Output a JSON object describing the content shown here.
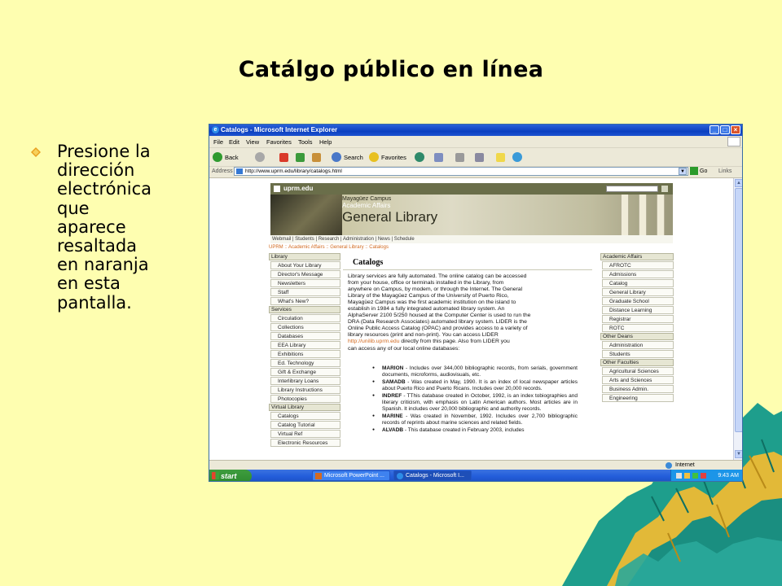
{
  "slide": {
    "title": "Catálgo público en línea",
    "bullet_lines": [
      "Presione la",
      "dirección",
      "electrónica",
      "que",
      "aparece",
      "resaltada",
      "en naranja",
      "en esta",
      "pantalla."
    ]
  },
  "window": {
    "title": "Catalogs - Microsoft Internet Explorer",
    "menu": [
      "File",
      "Edit",
      "View",
      "Favorites",
      "Tools",
      "Help"
    ],
    "toolbar": {
      "back": "Back",
      "search": "Search",
      "favorites": "Favorites"
    },
    "address_label": "Address",
    "address_url": "http://www.uprm.edu/library/catalogs.html",
    "go_label": "Go",
    "links_label": "Links",
    "status_zone": "Internet"
  },
  "page": {
    "site_label": "uprm.edu",
    "banner_campus": "Mayagüez Campus",
    "banner_affairs": "Academic Affairs",
    "banner_library": "General Library",
    "subnav": "Webmail | Students | Research | Administration | News | Schedule",
    "breadcrumb": "UPRM :: Academic Affairs :: General Library :: Catalogs",
    "left_nav": [
      {
        "header": "Library",
        "items": [
          "About Your Library",
          "Director's Message",
          "Newsletters",
          "Staff",
          "What's New?"
        ]
      },
      {
        "header": "Services",
        "items": [
          "Circulation",
          "Collections",
          "Databases",
          "EEA Library",
          "Exhibitions",
          "Ed. Technology",
          "Gift & Exchange",
          "Interlibrary Loans",
          "Library Instructions",
          "Photocopies"
        ]
      },
      {
        "header": "Virtual Library",
        "items": [
          "Catalogs",
          "Catalog Tutorial",
          "Virtual Ref",
          "Electronic Resources"
        ]
      }
    ],
    "right_nav": [
      {
        "header": "Academic Affairs",
        "items": [
          "AFROTC",
          "Admissions",
          "Catalog",
          "General Library",
          "Graduate School",
          "Distance Learning",
          "Registrar",
          "ROTC"
        ]
      },
      {
        "header": "Other Deans",
        "items": [
          "Administration",
          "Students"
        ]
      },
      {
        "header": "Other Faculties",
        "items": [
          "Agricultural Sciences",
          "Arts and Sciences",
          "Business Admin.",
          "Engineering"
        ]
      }
    ],
    "content_title": "Catalogs",
    "intro_lines": [
      "Library services are fully automated. The online catalog can be accessed",
      "from your house, office or terminals installed in the Library, from",
      "anywhere on Campus, by modem, or through the Internet. The General",
      "Library of the Mayagüez Campus of the University of Puerto Rico,",
      "Mayagüez Campus was the first academic institution on the island to",
      "establish in 1984 a fully integrated automated library system. An",
      "AlphaServer 2100 5/250 housed at the Computer Center is used to run the",
      "DRA (Data Research Associates) automated library system. LIDER is the",
      "Online Public Access Catalog (OPAC) and provides access to a variety of",
      "library resources (print and non-print). You can access LIDER"
    ],
    "intro_link": "http://unilib.uprm.edu",
    "intro_after_link": " directly from this page. Also from LIDER you",
    "intro_last": "can access any of our local online databases:",
    "databases": [
      {
        "name": "MARION",
        "desc": " - Includes over 344,000 bibliographic records, from serials, government documents, microforms, audiovisuals, etc."
      },
      {
        "name": "SAMADB",
        "desc": " - Was created in May, 1990. It is an index of local newspaper articles about Puerto Rico and Puerto Ricans. Includes over 20,000 records."
      },
      {
        "name": "INDREF",
        "desc": " - TThis database created in October, 1992, is an index tobiographies and literary criticism, with emphasis on Latin American authors. Most articles are in Spanish. It includes over 20,000 bibliographic and authority records."
      },
      {
        "name": "MARINE",
        "desc": " - Was created in November, 1992. Includes over 2,700 bibliographic records of reprints about marine sciences and related fields."
      },
      {
        "name": "ALVADB",
        "desc": " - This database created in February 2003, includes"
      }
    ]
  },
  "taskbar": {
    "start": "start",
    "tasks": [
      "Microsoft PowerPoint ...",
      "Catalogs - Microsoft I..."
    ],
    "clock": "9:43 AM"
  },
  "colors": {
    "slide_bg": "#fefeb0",
    "link_orange": "#d2691e",
    "mountain_teal": "#1e9e8c",
    "mountain_yellow": "#e2b938"
  }
}
